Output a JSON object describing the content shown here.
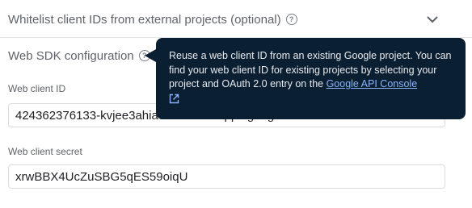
{
  "whitelist": {
    "title": "Whitelist client IDs from external projects (optional)"
  },
  "sdk": {
    "title": "Web SDK configuration"
  },
  "fields": {
    "client_id_label": "Web client ID",
    "client_id_value": "424362376133-kvjee3ahia0...cohsuo.apps.googleusercontent.com",
    "client_secret_label": "Web client secret",
    "client_secret_value": "xrwBBX4UcZuSBG5qES59oiqU"
  },
  "tooltip": {
    "text": "Reuse a web client ID from an existing Google project. You can find your web client ID for existing projects by selecting your project and OAuth 2.0 entry on the ",
    "link_text": "Google API Console"
  },
  "colors": {
    "tooltip_bg": "#0b1f33",
    "link": "#8ab4f8"
  },
  "icons": [
    "help-icon",
    "chevron-down-icon",
    "open-in-new-icon"
  ]
}
